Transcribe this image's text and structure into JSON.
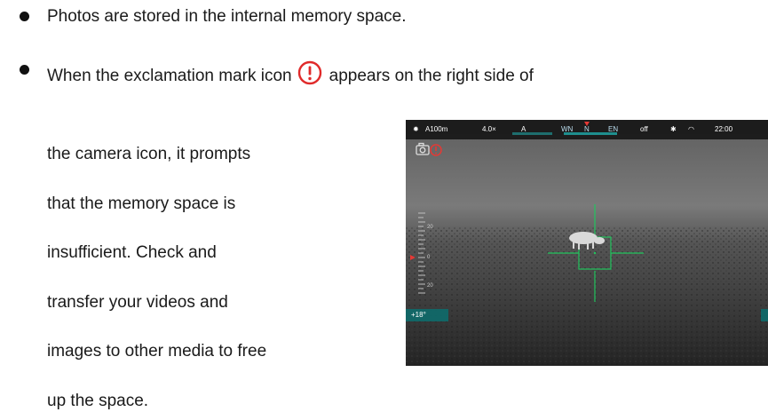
{
  "bullets": [
    "Photos are stored in the internal memory space.",
    "When the exclamation mark icon"
  ],
  "bullet2_suffix": "appears on the right side of",
  "paragraph_lines": [
    "the camera icon, it prompts",
    "that the memory space is",
    "insufficient. Check and",
    "transfer your videos and",
    "images to other media to free",
    "up the space."
  ],
  "icons": {
    "warning": "exclamation-circle-icon",
    "camera": "camera-icon"
  },
  "colors": {
    "warning": "#e02a2a",
    "reticle": "#22c55e",
    "hud_accent": "#e53935"
  },
  "screenshot": {
    "range": "A100m",
    "zoom": "4.0×",
    "mode": "A",
    "compass": [
      "WN",
      "N",
      "EN"
    ],
    "wifi_off": "off",
    "time": "22:00",
    "angle": "+18°",
    "scale_top": "20",
    "scale_mid": "0",
    "scale_bottom": "20"
  }
}
